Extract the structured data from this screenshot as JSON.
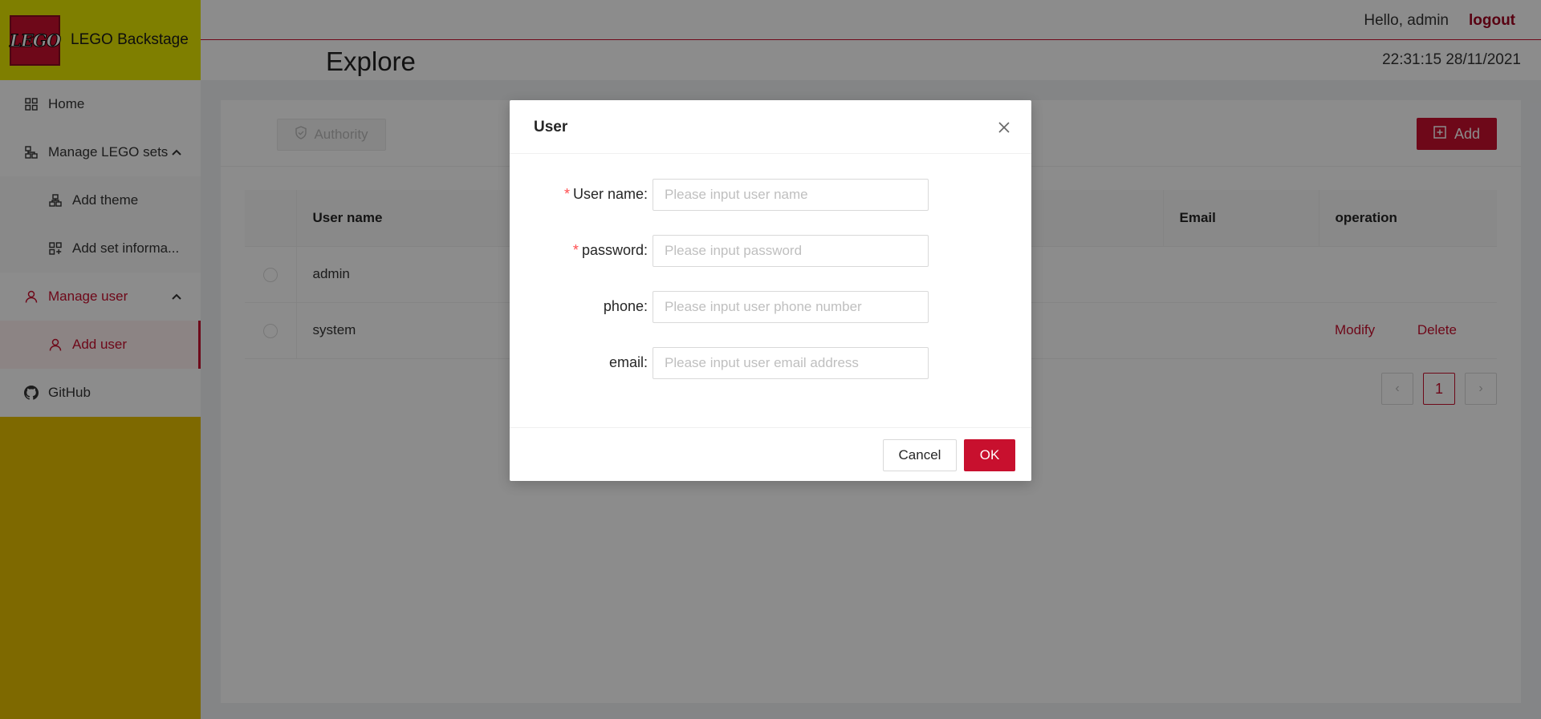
{
  "brand": {
    "logo_text": "LEGO",
    "title": "LEGO Backstage"
  },
  "sidebar": {
    "items": [
      {
        "label": "Home",
        "icon": "grid-icon"
      },
      {
        "label": "Manage LEGO sets",
        "icon": "sitemap-icon"
      },
      {
        "label": "Add theme",
        "icon": "sitemap-icon"
      },
      {
        "label": "Add set informa...",
        "icon": "grid-add-icon"
      },
      {
        "label": "Manage user",
        "icon": "user-icon"
      },
      {
        "label": "Add user",
        "icon": "user-icon"
      },
      {
        "label": "GitHub",
        "icon": "github-icon"
      }
    ]
  },
  "header": {
    "greeting": "Hello, admin",
    "logout_label": "logout",
    "page_title": "Explore",
    "datetime": "22:31:15 28/11/2021"
  },
  "toolbar": {
    "authority_label": "Authority",
    "add_label": "Add"
  },
  "table": {
    "columns": [
      "User name",
      "Email",
      "operation"
    ],
    "rows": [
      {
        "username": "admin",
        "email": "",
        "actions": []
      },
      {
        "username": "system",
        "email": "",
        "actions": [
          "Modify",
          "Delete"
        ]
      }
    ]
  },
  "pagination": {
    "current_page": "1",
    "prev": "‹",
    "next": "›"
  },
  "modal": {
    "title": "User",
    "fields": [
      {
        "label": "User name",
        "required": true,
        "placeholder": "Please input user name"
      },
      {
        "label": "password",
        "required": true,
        "placeholder": "Please input password"
      },
      {
        "label": "phone",
        "required": false,
        "placeholder": "Please input user phone number"
      },
      {
        "label": "email",
        "required": false,
        "placeholder": "Please input user email address"
      }
    ],
    "cancel_label": "Cancel",
    "ok_label": "OK"
  },
  "colors": {
    "accent": "#c8102e",
    "sidebar_yellow": "#e5c000",
    "brand_yellow": "#e8e800"
  }
}
